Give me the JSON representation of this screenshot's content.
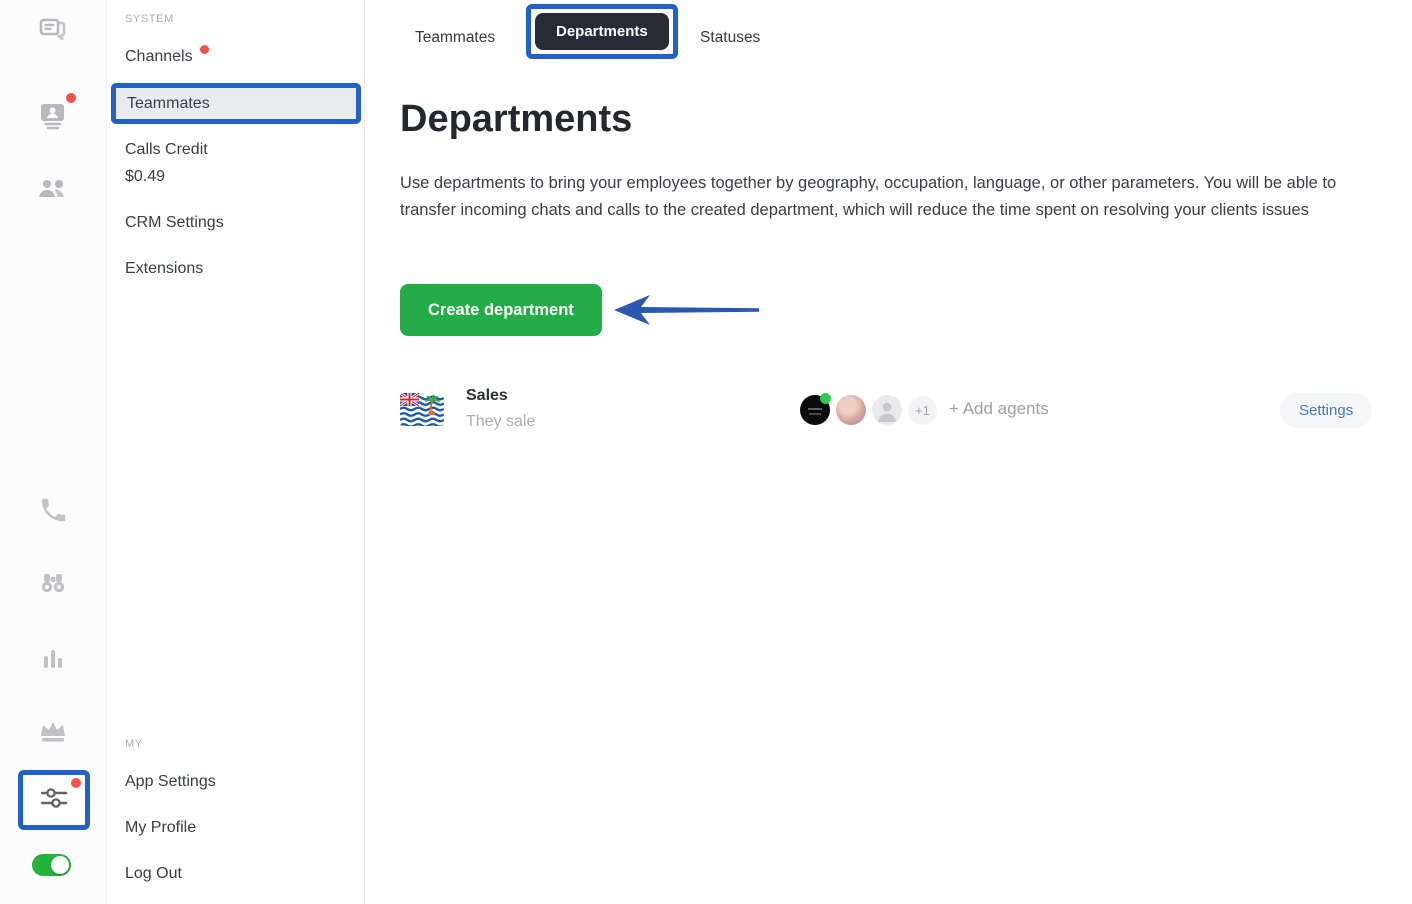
{
  "colors": {
    "annotation_blue": "#2161c8",
    "create_button_green": "#23ac47",
    "toggle_green": "#23b33a",
    "notification_red": "#f5504a",
    "selected_tab_bg": "#272c34",
    "settings_link_blue": "#4775c9"
  },
  "icon_rail": {
    "icons": [
      "chat-icon",
      "contacts-icon",
      "team-icon",
      "phone-icon",
      "binoculars-icon",
      "bar-chart-icon",
      "crown-icon",
      "sliders-icon"
    ],
    "notifications": [
      "contacts-icon",
      "sliders-icon"
    ],
    "online_toggle_state": "on"
  },
  "sidebar": {
    "system_label": "SYSTEM",
    "items": [
      {
        "label": "Channels",
        "has_dot": true
      },
      {
        "label": "Teammates",
        "selected": true,
        "annotated": true
      },
      {
        "label": "Calls Credit",
        "value": "$0.49"
      },
      {
        "label": "CRM Settings"
      },
      {
        "label": "Extensions"
      }
    ],
    "my_label": "MY",
    "my_items": [
      {
        "label": "App Settings"
      },
      {
        "label": "My Profile"
      },
      {
        "label": "Log Out"
      }
    ]
  },
  "tabs": [
    {
      "label": "Teammates"
    },
    {
      "label": "Departments",
      "selected": true,
      "annotated": true
    },
    {
      "label": "Statuses"
    }
  ],
  "page": {
    "title": "Departments",
    "description": "Use departments to bring your employees together by geography, occupation, language, or other parameters. You will be able to transfer incoming chats and calls to the created department, which will reduce the time spent on resolving your clients issues",
    "create_button_label": "Create department"
  },
  "departments": [
    {
      "name": "Sales",
      "description": "They sale",
      "flag": "british-indian-ocean-territory-flag",
      "avatars": [
        {
          "type": "dark-photo",
          "online": true
        },
        {
          "type": "photo"
        },
        {
          "type": "placeholder"
        }
      ],
      "overflow_count": "+1",
      "add_agents_label": "+ Add agents",
      "settings_label": "Settings"
    }
  ]
}
